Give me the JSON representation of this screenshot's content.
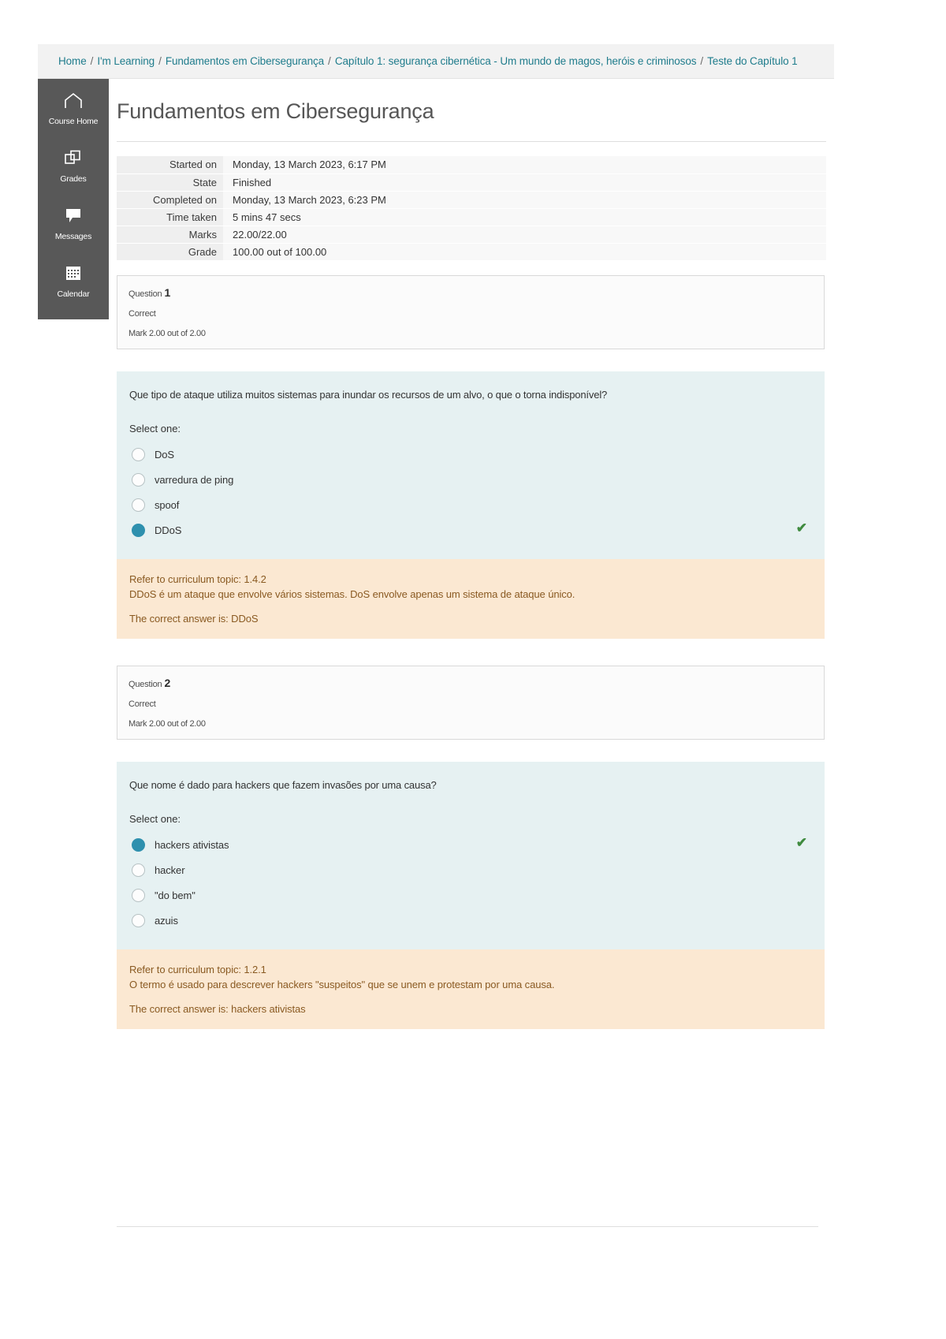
{
  "breadcrumb": {
    "separator": "/",
    "items": [
      "Home",
      "I'm Learning",
      "Fundamentos em Cibersegurança",
      "Capítulo 1: segurança cibernética - Um mundo de magos, heróis e criminosos",
      "Teste do Capítulo 1"
    ]
  },
  "rail": {
    "items": [
      {
        "icon": "home-icon",
        "label": "Course Home"
      },
      {
        "icon": "grades-icon",
        "label": "Grades"
      },
      {
        "icon": "messages-icon",
        "label": "Messages"
      },
      {
        "icon": "calendar-icon",
        "label": "Calendar"
      }
    ]
  },
  "page": {
    "title": "Fundamentos em Cibersegurança"
  },
  "summary": {
    "rows": [
      {
        "key": "Started on",
        "value": "Monday, 13 March 2023, 6:17 PM"
      },
      {
        "key": "State",
        "value": "Finished"
      },
      {
        "key": "Completed on",
        "value": "Monday, 13 March 2023, 6:23 PM"
      },
      {
        "key": "Time taken",
        "value": "5 mins 47 secs"
      },
      {
        "key": "Marks",
        "value": "22.00/22.00"
      },
      {
        "key": "Grade",
        "value": "100.00 out of 100.00"
      }
    ]
  },
  "questions": [
    {
      "label": "Question",
      "number": "1",
      "state": "Correct",
      "mark": "Mark 2.00 out of 2.00",
      "text": "Que tipo de ataque utiliza muitos sistemas para inundar os recursos de um alvo, o que o torna indisponível?",
      "select_label": "Select one:",
      "options": [
        {
          "label": "DoS",
          "selected": false,
          "correct_mark": false
        },
        {
          "label": "varredura de ping",
          "selected": false,
          "correct_mark": false
        },
        {
          "label": "spoof",
          "selected": false,
          "correct_mark": false
        },
        {
          "label": "DDoS",
          "selected": true,
          "correct_mark": true
        }
      ],
      "feedback": {
        "reference": "Refer to curriculum topic: 1.4.2",
        "explanation": "DDoS é um ataque que envolve vários sistemas. DoS envolve apenas um sistema de ataque único.",
        "correct_answer": "The correct answer is: DDoS"
      }
    },
    {
      "label": "Question",
      "number": "2",
      "state": "Correct",
      "mark": "Mark 2.00 out of 2.00",
      "text": "Que nome é dado para hackers que fazem invasões por uma causa?",
      "select_label": "Select one:",
      "options": [
        {
          "label": "hackers ativistas",
          "selected": true,
          "correct_mark": true
        },
        {
          "label": "hacker",
          "selected": false,
          "correct_mark": false
        },
        {
          "label": "\"do bem\"",
          "selected": false,
          "correct_mark": false
        },
        {
          "label": "azuis",
          "selected": false,
          "correct_mark": false
        }
      ],
      "feedback": {
        "reference": "Refer to curriculum topic: 1.2.1",
        "explanation": "O termo é usado para descrever hackers \"suspeitos\" que se unem e protestam por uma causa.",
        "correct_answer": "The correct answer is: hackers ativistas"
      }
    }
  ],
  "icons": {
    "check": "✔"
  },
  "colors": {
    "link": "#1f7c8c",
    "rail_bg": "#585858",
    "question_bg": "#e6f1f2",
    "feedback_bg": "#fbe8d2",
    "radio_selected": "#2e90ae",
    "check": "#3f8b3f"
  }
}
